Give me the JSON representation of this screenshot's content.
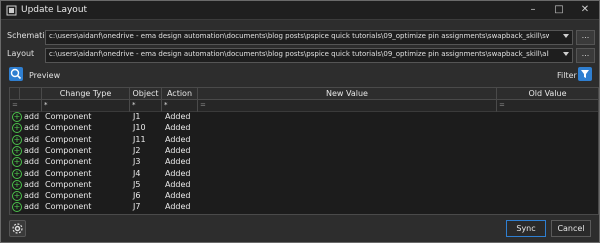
{
  "window": {
    "title": "Update Layout"
  },
  "schematic": {
    "label": "Schematic",
    "path": "c:\\users\\aidanf\\onedrive - ema design automation\\documents\\blog posts\\pspice quick tutorials\\09_optimize pin assignments\\swapback_skill\\swapback_example.opj",
    "browse": "..."
  },
  "layout": {
    "label": "Layout",
    "path": "c:\\users\\aidanf\\onedrive - ema design automation\\documents\\blog posts\\pspice quick tutorials\\09_optimize pin assignments\\swapback_skill\\allegro\\swapback_example.brd",
    "browse": "..."
  },
  "toolbar": {
    "preview_label": "Preview",
    "filter_label": "Filter"
  },
  "grid": {
    "columns": [
      "Change Type",
      "Object",
      "Action",
      "New Value",
      "Old Value"
    ],
    "filters": [
      "*",
      "*",
      "*",
      "",
      ""
    ],
    "filter_ops": [
      "=",
      "=",
      "=",
      "=",
      "="
    ],
    "rows": [
      {
        "icon": "add",
        "type": "Component",
        "object": "J1",
        "action": "Added"
      },
      {
        "icon": "add",
        "type": "Component",
        "object": "J10",
        "action": "Added"
      },
      {
        "icon": "add",
        "type": "Component",
        "object": "J11",
        "action": "Added"
      },
      {
        "icon": "add",
        "type": "Component",
        "object": "J2",
        "action": "Added"
      },
      {
        "icon": "add",
        "type": "Component",
        "object": "J3",
        "action": "Added"
      },
      {
        "icon": "add",
        "type": "Component",
        "object": "J4",
        "action": "Added"
      },
      {
        "icon": "add",
        "type": "Component",
        "object": "J5",
        "action": "Added"
      },
      {
        "icon": "add",
        "type": "Component",
        "object": "J6",
        "action": "Added"
      },
      {
        "icon": "add",
        "type": "Component",
        "object": "J7",
        "action": "Added"
      }
    ]
  },
  "buttons": {
    "sync": "Sync",
    "cancel": "Cancel"
  },
  "colors": {
    "accent": "#2f7fd1",
    "add_green": "#4cc24c"
  }
}
